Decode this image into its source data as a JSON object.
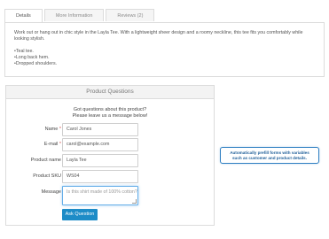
{
  "tabs": [
    {
      "label": "Details"
    },
    {
      "label": "More Information"
    },
    {
      "label": "Reviews (2)"
    }
  ],
  "details": {
    "description": "Work out or hang out in chic style in the Layla Tee. With a lightweight sheer design and a roomy neckline, this tee fits you comfortably while looking stylish.",
    "bullets": [
      "Teal tee.",
      "Long back hem.",
      "Dropped shoulders."
    ]
  },
  "form": {
    "title": "Product Questions",
    "intro_line1": "Got questions about this product?",
    "intro_line2": "Please leave us a message below!",
    "fields": {
      "name": {
        "label": "Name",
        "value": "Carol Jones",
        "required": "*"
      },
      "email": {
        "label": "E-mail",
        "value": "carol@example.com",
        "required": "*"
      },
      "product_name": {
        "label": "Product name",
        "value": "Layla Tee"
      },
      "product_sku": {
        "label": "Product SKU",
        "value": "WS04"
      },
      "message": {
        "label": "Message",
        "placeholder": "Is this shirt made of 100% cotton?"
      }
    },
    "submit_label": "Ask Question"
  },
  "callout": {
    "line1": "Automatically prefill forms with variables",
    "line2": "such as customer and product details."
  }
}
